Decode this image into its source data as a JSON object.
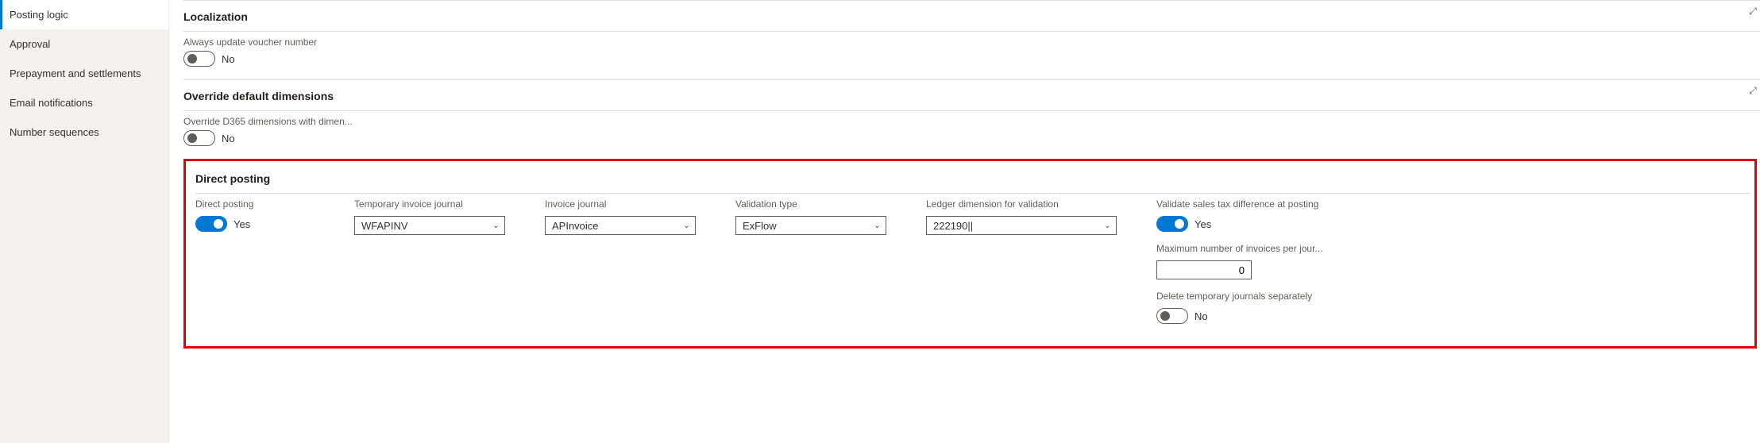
{
  "sidebar": {
    "items": [
      {
        "label": "Posting logic"
      },
      {
        "label": "Approval"
      },
      {
        "label": "Prepayment and settlements"
      },
      {
        "label": "Email notifications"
      },
      {
        "label": "Number sequences"
      }
    ]
  },
  "localization": {
    "title": "Localization",
    "update_voucher_label": "Always update voucher number",
    "update_voucher_value": "No"
  },
  "override_dims": {
    "title": "Override default dimensions",
    "override_label": "Override D365 dimensions with dimen...",
    "override_value": "No"
  },
  "direct_posting": {
    "title": "Direct posting",
    "direct_posting_label": "Direct posting",
    "direct_posting_value": "Yes",
    "temp_journal_label": "Temporary invoice journal",
    "temp_journal_value": "WFAPINV",
    "invoice_journal_label": "Invoice journal",
    "invoice_journal_value": "APInvoice",
    "validation_type_label": "Validation type",
    "validation_type_value": "ExFlow",
    "ledger_dim_label": "Ledger dimension for validation",
    "ledger_dim_value": "222190||",
    "validate_tax_label": "Validate sales tax difference at posting",
    "validate_tax_value": "Yes",
    "max_invoices_label": "Maximum number of invoices per jour...",
    "max_invoices_value": "0",
    "delete_temp_label": "Delete temporary journals separately",
    "delete_temp_value": "No"
  }
}
